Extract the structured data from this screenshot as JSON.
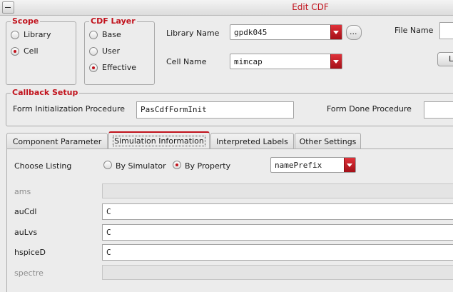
{
  "window": {
    "title": "Edit CDF"
  },
  "scope": {
    "title": "Scope",
    "options": [
      {
        "label": "Library",
        "selected": false
      },
      {
        "label": "Cell",
        "selected": true
      }
    ]
  },
  "cdf_layer": {
    "title": "CDF Layer",
    "options": [
      {
        "label": "Base",
        "selected": false
      },
      {
        "label": "User",
        "selected": false
      },
      {
        "label": "Effective",
        "selected": true
      }
    ]
  },
  "library": {
    "label": "Library Name",
    "value": "gpdk045",
    "browse_label": "..."
  },
  "cell": {
    "label": "Cell Name",
    "value": "mimcap"
  },
  "file": {
    "label": "File Name",
    "button_label": "L"
  },
  "callback": {
    "title": "Callback Setup",
    "init_label": "Form Initialization Procedure",
    "init_value": "PasCdfFormInit",
    "done_label": "Form Done Procedure",
    "done_value": ""
  },
  "tabs": [
    {
      "label": "Component Parameter",
      "active": false
    },
    {
      "label": "Simulation Information",
      "active": true
    },
    {
      "label": "Interpreted Labels",
      "active": false
    },
    {
      "label": "Other Settings",
      "active": false
    }
  ],
  "sim": {
    "choose_label": "Choose Listing",
    "by_simulator_label": "By Simulator",
    "by_property_label": "By Property",
    "listing_mode": "By Property",
    "property_value": "namePrefix",
    "rows": [
      {
        "label": "ams",
        "value": "",
        "enabled": false
      },
      {
        "label": "auCdl",
        "value": "C",
        "enabled": true
      },
      {
        "label": "auLvs",
        "value": "C",
        "enabled": true
      },
      {
        "label": "hspiceD",
        "value": "C",
        "enabled": true
      },
      {
        "label": "spectre",
        "value": "",
        "enabled": false
      }
    ]
  },
  "colors": {
    "accent": "#c1121c",
    "background": "#ececec"
  }
}
